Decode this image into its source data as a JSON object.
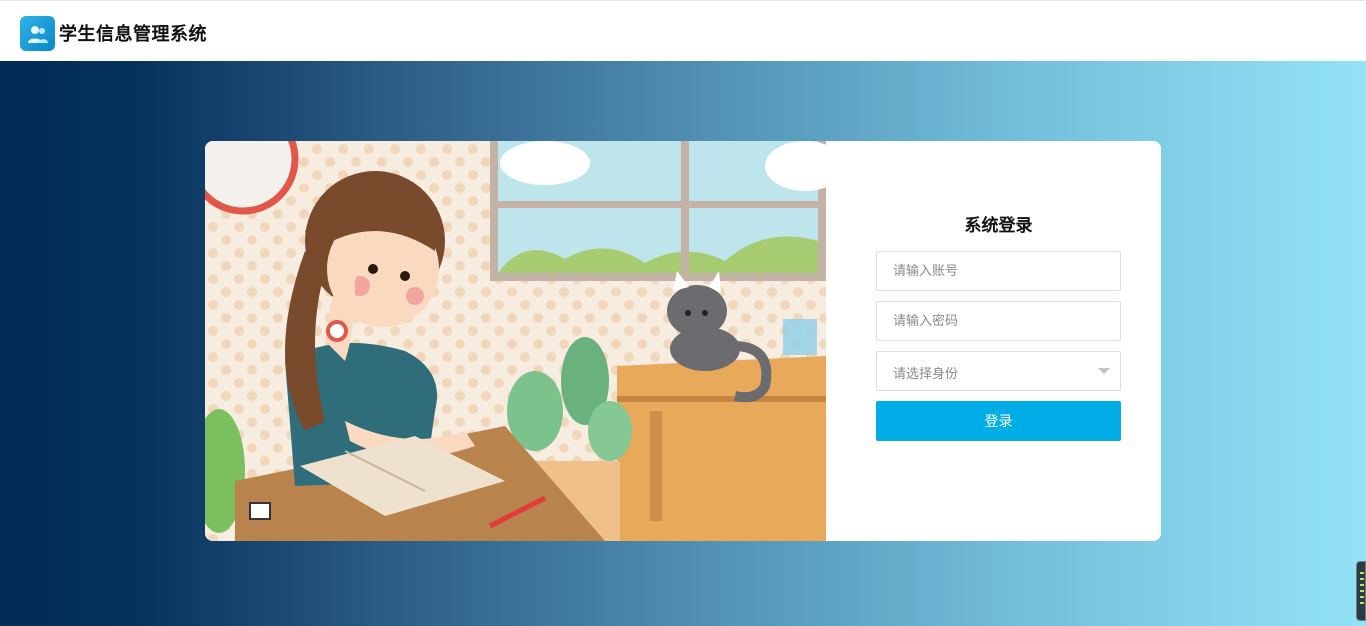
{
  "app": {
    "title": "学生信息管理系统",
    "logo_icon": "user-group-icon"
  },
  "login": {
    "title": "系统登录",
    "username_placeholder": "请输入账号",
    "password_placeholder": "请输入密码",
    "role_select": {
      "selected": "请选择身份",
      "icon": "chevron-down-icon"
    },
    "submit_label": "登录"
  },
  "colors": {
    "accent": "#00ade6",
    "background_left": "#022b56",
    "background_right": "#93e3f5"
  },
  "illustration": {
    "subject": "girl-reading-with-cat-icon"
  }
}
